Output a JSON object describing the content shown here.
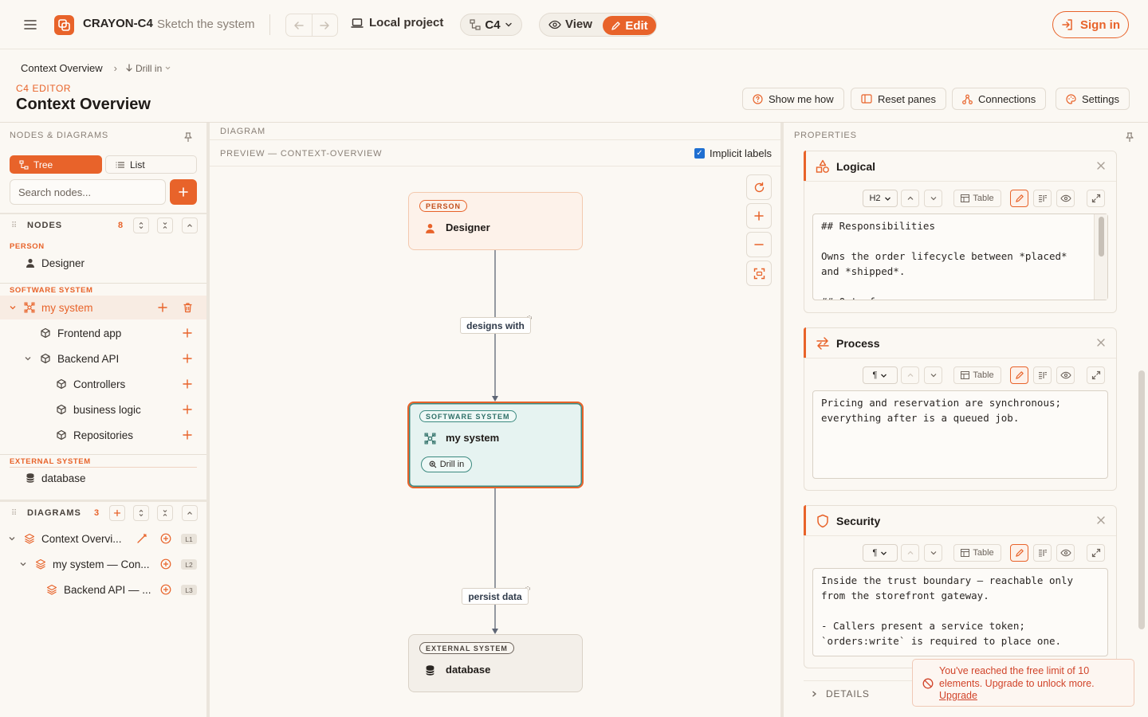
{
  "app": {
    "brand": "CRAYON-C4",
    "tagline": "Sketch the system",
    "project": "Local project",
    "notation": "C4",
    "mode_view": "View",
    "mode_edit": "Edit",
    "sign_in": "Sign in",
    "accent": "#e8632a"
  },
  "breadcrumb": {
    "current": "Context Overview",
    "separator": "›",
    "drill": "Drill in"
  },
  "page": {
    "eyebrow": "C4 EDITOR",
    "title": "Context Overview",
    "actions": {
      "show_me_how": "Show me how",
      "reset_panes": "Reset panes",
      "connections": "Connections",
      "settings": "Settings"
    }
  },
  "left": {
    "title": "NODES & DIAGRAMS",
    "tree_label": "Tree",
    "list_label": "List",
    "search_placeholder": "Search nodes...",
    "nodes_title": "NODES",
    "nodes_count": "8",
    "groups": {
      "person": "PERSON",
      "software": "SOFTWARE SYSTEM",
      "external": "EXTERNAL SYSTEM"
    },
    "nodes": {
      "designer": "Designer",
      "my_system": "my system",
      "frontend": "Frontend app",
      "backend": "Backend API",
      "controllers": "Controllers",
      "business": "business logic",
      "repositories": "Repositories",
      "database": "database"
    },
    "diagrams_title": "DIAGRAMS",
    "diagrams_count": "3",
    "diagrams": [
      {
        "label": "Context Overvi...",
        "level": "L1"
      },
      {
        "label": "my system — Con...",
        "level": "L2"
      },
      {
        "label": "Backend API — ...",
        "level": "L3"
      }
    ]
  },
  "diagram": {
    "header": "DIAGRAM",
    "preview": "PREVIEW — CONTEXT-OVERVIEW",
    "implicit_labels": "Implicit labels",
    "nodes": {
      "person_tag": "PERSON",
      "person_name": "Designer",
      "system_tag": "SOFTWARE SYSTEM",
      "system_name": "my system",
      "drill": "Drill in",
      "external_tag": "EXTERNAL SYSTEM",
      "external_name": "database"
    },
    "edges": {
      "e1": "designs with",
      "e2": "persist data"
    }
  },
  "properties": {
    "title": "PROPERTIES",
    "table_label": "Table",
    "cards": [
      {
        "title": "Logical",
        "heading": "H2",
        "text": "## Responsibilities\n\nOwns the order lifecycle between *placed*\nand *shipped*.\n\n## Out of scope"
      },
      {
        "title": "Process",
        "heading": "¶",
        "text": "Pricing and reservation are synchronous;\neverything after is a queued job."
      },
      {
        "title": "Security",
        "heading": "¶",
        "text": "Inside the trust boundary — reachable only\nfrom the storefront gateway.\n\n- Callers present a service token;\n`orders:write` is required to place one."
      }
    ],
    "details": "DETAILS"
  },
  "toast": {
    "message": "You've reached the free limit of 10 elements. Upgrade to unlock more.",
    "link": "Upgrade"
  }
}
